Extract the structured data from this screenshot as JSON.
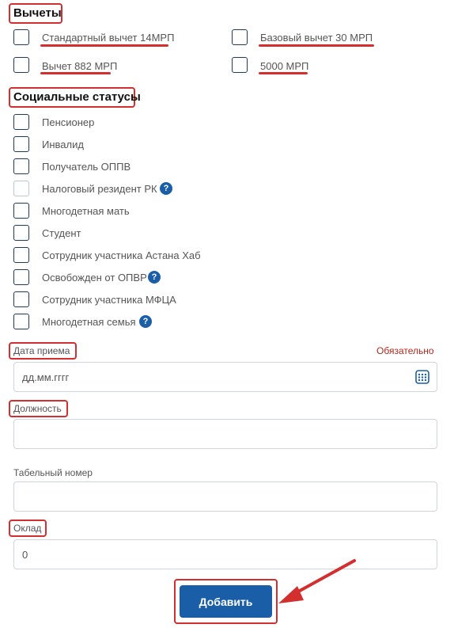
{
  "deductions": {
    "title": "Вычеты",
    "items": [
      {
        "label": "Стандартный вычет 14МРП"
      },
      {
        "label": "Базовый вычет 30 МРП"
      },
      {
        "label": "Вычет 882 МРП"
      },
      {
        "label": "5000 МРП"
      }
    ]
  },
  "social_statuses": {
    "title": "Социальные статусы",
    "items": [
      {
        "label": "Пенсионер"
      },
      {
        "label": "Инвалид"
      },
      {
        "label": "Получатель ОППВ"
      },
      {
        "label": "Налоговый резидент РК"
      },
      {
        "label": "Многодетная мать"
      },
      {
        "label": "Студент"
      },
      {
        "label": "Сотрудник участника Астана Хаб"
      },
      {
        "label": "Освобожден от ОПВР"
      },
      {
        "label": "Сотрудник участника МФЦА"
      },
      {
        "label": "Многодетная семья"
      }
    ],
    "help_symbol": "?"
  },
  "form": {
    "hire_date": {
      "label": "Дата приема",
      "required": "Обязательно",
      "placeholder": "дд.мм.гггг"
    },
    "position": {
      "label": "Должность",
      "value": ""
    },
    "personnel_number": {
      "label": "Табельный номер",
      "value": ""
    },
    "salary": {
      "label": "Оклад",
      "value": "0"
    }
  },
  "actions": {
    "add_label": "Добавить"
  },
  "colors": {
    "accent": "#1a5ea8",
    "highlight": "#d32f2f",
    "required": "#b3261e"
  },
  "icons": {
    "calendar": "calendar-icon",
    "help": "help-icon",
    "arrow": "arrow-annotation"
  }
}
